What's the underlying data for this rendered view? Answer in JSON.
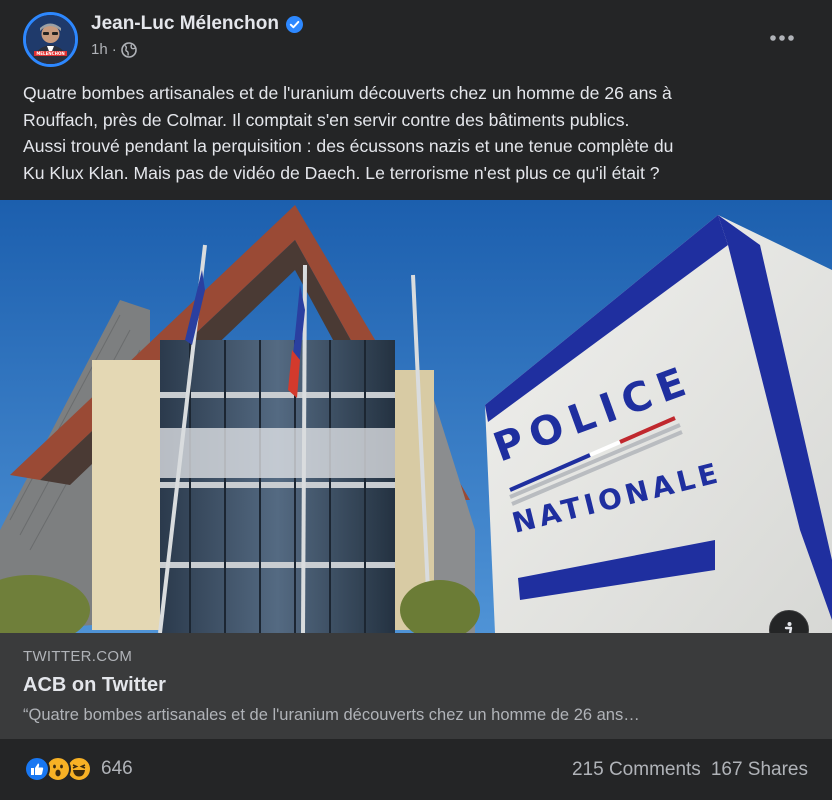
{
  "post": {
    "author": "Jean-Luc Mélenchon",
    "time": "1h",
    "meta_separator": "·",
    "text_lines": [
      "Quatre bombes artisanales et de l'uranium découverts chez un homme de 26 ans à",
      "Rouffach, près de Colmar. Il comptait s'en servir contre des bâtiments publics.",
      "Aussi trouvé pendant la perquisition : des écussons nazis et une tenue complète du",
      "Ku Klux Klan. Mais pas de vidéo de Daech. Le terrorisme n'est plus ce qu'il était ?"
    ]
  },
  "image": {
    "sign_line1": "POLICE",
    "sign_line2": "NATIONALE"
  },
  "link": {
    "domain": "TWITTER.COM",
    "title": "ACB on Twitter",
    "description": "“Quatre bombes artisanales et de l'uranium découverts chez un homme de 26 ans…"
  },
  "footer": {
    "reaction_count": "646",
    "comments": "215 Comments",
    "shares": "167 Shares"
  },
  "icons": {
    "verified": "verified-badge-icon",
    "audience": "globe-icon",
    "more": "more-options-icon",
    "info": "info-icon",
    "reactions": [
      "like-icon",
      "wow-icon",
      "haha-icon"
    ]
  },
  "colors": {
    "background": "#242526",
    "card": "#3a3b3c",
    "text_primary": "#e4e6eb",
    "text_secondary": "#b0b3b8",
    "accent": "#2d88ff"
  }
}
